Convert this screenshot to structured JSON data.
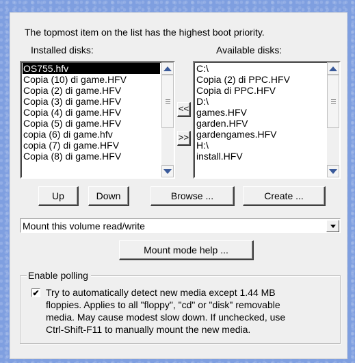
{
  "header": {
    "priority_note": "The topmost item on the list has the highest boot priority.",
    "installed_label": "Installed disks:",
    "available_label": "Available disks:"
  },
  "installed_disks": [
    "OS755.hfv",
    "Copia (10) di game.HFV",
    "Copia (2) di game.HFV",
    "Copia (3) di game.HFV",
    "Copia (4) di game.HFV",
    "Copia (5) di game.HFV",
    "copia (6) di game.hfv",
    "copia (7) di game.HFV",
    "Copia (8) di game.HFV"
  ],
  "installed_selected_index": 0,
  "available_disks": [
    "C:\\",
    "Copia (2) di PPC.HFV",
    "Copia di PPC.HFV",
    "D:\\",
    "games.HFV",
    "garden.HFV",
    "gardengames.HFV",
    "H:\\",
    "install.HFV"
  ],
  "transfer": {
    "add_label": "<<",
    "remove_label": ">>"
  },
  "buttons": {
    "up": "Up",
    "down": "Down",
    "browse": "Browse ...",
    "create": "Create ..."
  },
  "mount_mode": {
    "selected": "Mount this volume read/write",
    "help_label": "Mount mode help ..."
  },
  "polling": {
    "group_label": "Enable polling",
    "checked": true,
    "check_glyph": "✔",
    "description": [
      "Try to automatically detect new media except 1.44 MB",
      "floppies. Applies to all \"floppy\", \"cd\" or \"disk\" removable",
      "media. May cause modest slow down. If unchecked, use",
      "Ctrl-Shift-F11 to manually mount the new media."
    ]
  },
  "colors": {
    "selection_bg": "#000000",
    "scroll_arrow": "#3a5a9a",
    "desktop_bg": "#7f9fe0"
  }
}
